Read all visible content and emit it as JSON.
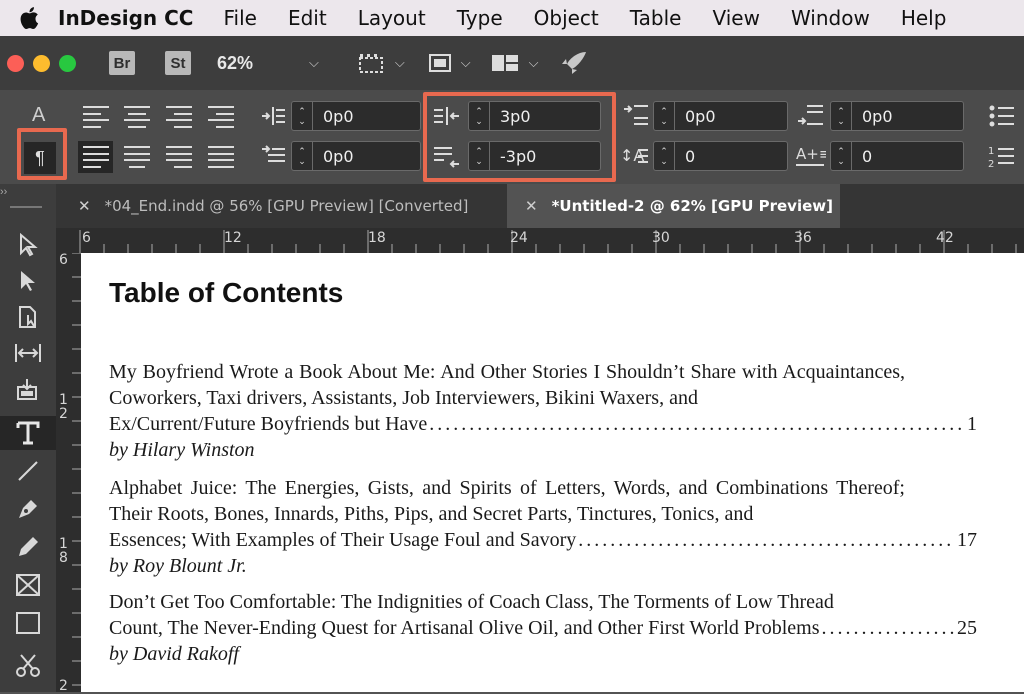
{
  "menubar": {
    "app_name": "InDesign CC",
    "items": [
      "File",
      "Edit",
      "Layout",
      "Type",
      "Object",
      "Table",
      "View",
      "Window",
      "Help"
    ]
  },
  "appbar": {
    "bridge_label": "Br",
    "stock_label": "St",
    "zoom": "62%"
  },
  "control": {
    "char_mode_label": "A",
    "para_mode_label": "¶",
    "left_indent": "0p0",
    "first_line_indent": "0p0",
    "right_indent": "3p0",
    "last_line_right_indent": "-3p0",
    "space_before": "0p0",
    "space_after": "0p0",
    "drop_cap_lines": "0",
    "drop_cap_chars": "0",
    "highlight_color": "#e8694f"
  },
  "tabs": [
    {
      "label": "*04_End.indd @ 56% [GPU Preview] [Converted]",
      "active": false
    },
    {
      "label": "*Untitled-2 @ 62% [GPU Preview]",
      "active": true
    }
  ],
  "ruler": {
    "h_marks": [
      "6",
      "12",
      "18",
      "24",
      "30",
      "36",
      "42"
    ],
    "v_marks": [
      "6",
      "1\n2",
      "1\n8",
      "2"
    ]
  },
  "document": {
    "title": "Table of Contents",
    "entries": [
      {
        "text": "My Boyfriend Wrote a Book About Me: And Other Stories I Shouldn’t Share with Acquaintances, Coworkers, Taxi drivers, Assistants, Job Interviewers, Bikini Waxers, and",
        "last_line": "Ex/Current/Future Boyfriends but Have",
        "page": "1",
        "author": "by Hilary Winston"
      },
      {
        "text": "Alphabet Juice: The Energies, Gists, and Spirits of Letters, Words, and Combinations Thereof; Their Roots, Bones, Innards, Piths, Pips, and Secret Parts, Tinctures, Tonics, and",
        "last_line": "Essences; With Examples of Their Usage Foul and Savory",
        "page": "17",
        "author": "by Roy Blount Jr."
      },
      {
        "text": "Don’t Get Too Comfortable: The Indignities of Coach Class, The Torments of Low Thread",
        "last_line": "Count, The Never-Ending Quest for Artisanal Olive Oil, and Other First World Problems",
        "page": "25",
        "author": "by David Rakoff"
      }
    ]
  }
}
